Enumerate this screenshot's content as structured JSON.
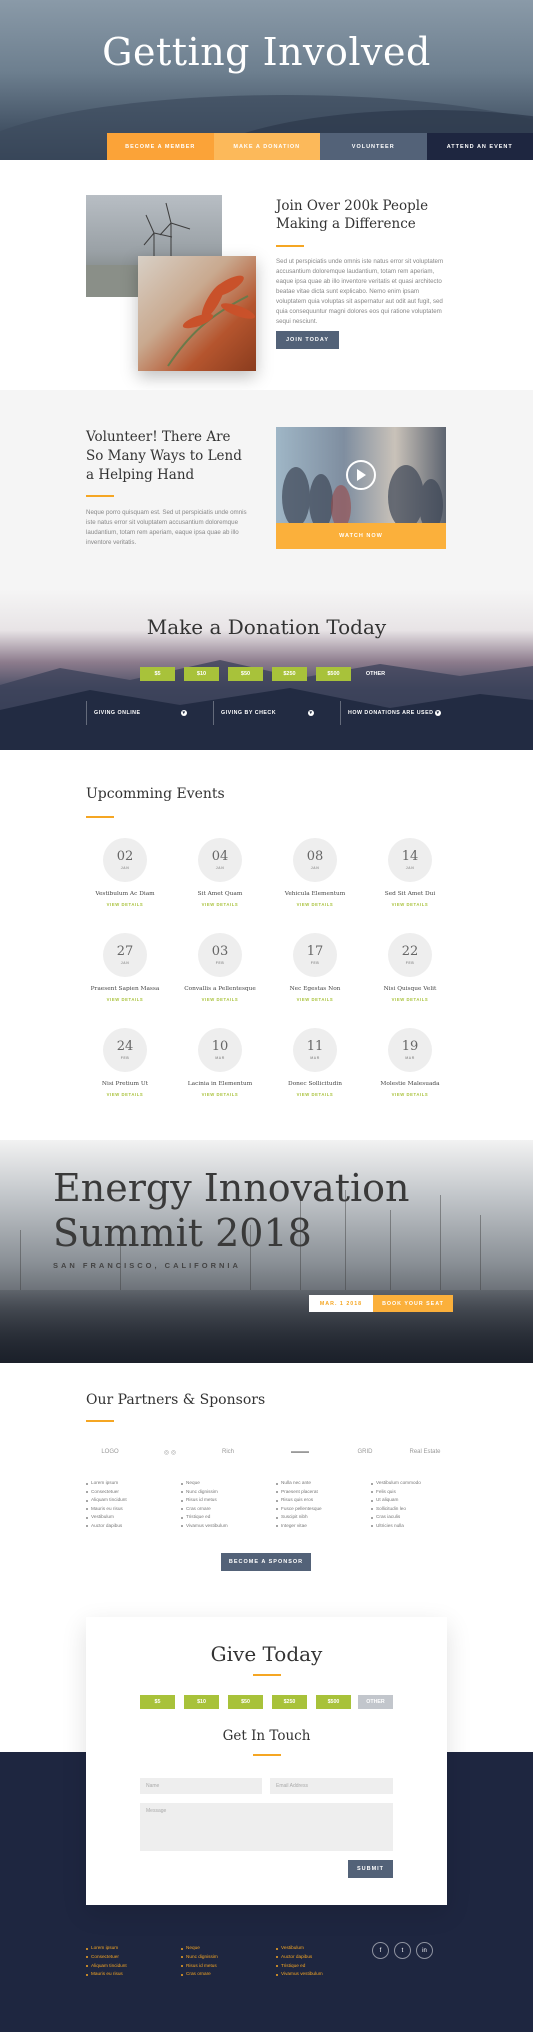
{
  "hero": {
    "title": "Getting Involved",
    "tabs": [
      {
        "label": "BECOME A MEMBER",
        "color": "#fba338"
      },
      {
        "label": "MAKE A DONATION",
        "color": "#fcb95a"
      },
      {
        "label": "VOLUNTEER",
        "color": "#536278"
      },
      {
        "label": "ATTEND AN EVENT",
        "color": "#1e2640"
      }
    ]
  },
  "join": {
    "title": "Join Over 200k People Making a Difference",
    "body": "Sed ut perspiciatis unde omnis iste natus error sit voluptatem accusantium doloremque laudantium, totam rem aperiam, eaque ipsa quae ab illo inventore veritatis et quasi architecto beatae vitae dicta sunt explicabo. Nemo enim ipsam voluptatem quia voluptas sit aspernatur aut odit aut fugit, sed quia consequuntur magni dolores eos qui ratione voluptatem sequi nesciunt.",
    "button": "JOIN TODAY"
  },
  "volunteer": {
    "title": "Volunteer! There Are So Many Ways to Lend a Helping Hand",
    "body": "Neque porro quisquam est. Sed ut perspiciatis unde omnis iste natus error sit voluptatem accusantium doloremque laudantium, totam rem aperiam, eaque ipsa quae ab illo inventore veritatis.",
    "watch": "WATCH NOW"
  },
  "donation": {
    "title": "Make a Donation Today",
    "amounts": [
      "$5",
      "$10",
      "$50",
      "$250",
      "$500"
    ],
    "other": "OTHER",
    "toggles": [
      "GIVING ONLINE",
      "GIVING BY CHECK",
      "HOW DONATIONS ARE USED"
    ],
    "accent": "#a8c23a"
  },
  "events": {
    "title": "Upcomming Events",
    "link": "VIEW DETAILS",
    "items": [
      {
        "day": "02",
        "month": "JAN",
        "name": "Vestibulum Ac Diam"
      },
      {
        "day": "04",
        "month": "JAN",
        "name": "Sit Amet Quam"
      },
      {
        "day": "08",
        "month": "JAN",
        "name": "Vehicula Elementum"
      },
      {
        "day": "14",
        "month": "JAN",
        "name": "Sed Sit Amet Dui"
      },
      {
        "day": "27",
        "month": "JAN",
        "name": "Praesent Sapien Massa"
      },
      {
        "day": "03",
        "month": "FEB",
        "name": "Convallis a Pellentesque"
      },
      {
        "day": "17",
        "month": "FEB",
        "name": "Nec Egestas Non"
      },
      {
        "day": "22",
        "month": "FEB",
        "name": "Nisi Quisque Velit"
      },
      {
        "day": "24",
        "month": "FEB",
        "name": "Nisi Pretium Ut"
      },
      {
        "day": "10",
        "month": "MAR",
        "name": "Lacinia in Elementum"
      },
      {
        "day": "11",
        "month": "MAR",
        "name": "Donec Sollicitudin"
      },
      {
        "day": "19",
        "month": "MAR",
        "name": "Molestie Malesuada"
      }
    ]
  },
  "summit": {
    "title_line1": "Energy Innovation",
    "title_line2": "Summit 2018",
    "location": "SAN FRANCISCO, CALIFORNIA",
    "date": "MAR. 1 2018",
    "button": "BOOK YOUR SEAT"
  },
  "partners": {
    "title": "Our Partners & Sponsors",
    "logos": [
      "LOGO",
      "◎ ◎",
      "Rich",
      "▬▬▬",
      "GRID",
      "Real Estate"
    ],
    "columns": [
      [
        "Lorem ipsum",
        "Consectetuer",
        "Aliquam tincidunt",
        "Mauris eu risus",
        "Vestibulum",
        "Auctor dapibus"
      ],
      [
        "Neque",
        "Nunc dignissim",
        "Risus id metus",
        "Cras ornare",
        "Tristique ed",
        "Vivamus vestibulum"
      ],
      [
        "Nulla nec ante",
        "Praesent placerat",
        "Risus quis eros",
        "Fusce pellentesque",
        "Suscipit nibh",
        "Integer vitae"
      ],
      [
        "Vestibulum commodo",
        "Felis quis",
        "Ut aliquam",
        "Sollicitudin leo",
        "Cras iaculis",
        "Ultricies nulla"
      ]
    ],
    "button": "BECOME A SPONSOR"
  },
  "give": {
    "title": "Give Today",
    "amounts": [
      "$5",
      "$10",
      "$50",
      "$250",
      "$500"
    ],
    "other": "OTHER",
    "contact_title": "Get In Touch",
    "name_ph": "Name",
    "email_ph": "Email Address",
    "message_ph": "Message",
    "submit": "SUBMIT"
  },
  "footer": {
    "columns": [
      [
        "Lorem ipsum",
        "Consectetuer",
        "Aliquam tincidunt",
        "Mauris eu risus"
      ],
      [
        "Neque",
        "Nunc dignissim",
        "Risus id metus",
        "Cras ornare"
      ],
      [
        "Vestibulum",
        "Auctor dapibus",
        "Tristique ed",
        "Vivamus vestibulum"
      ]
    ],
    "social": [
      "f",
      "t",
      "in"
    ],
    "social_icons": [
      "facebook-icon",
      "twitter-icon",
      "linkedin-icon"
    ]
  }
}
